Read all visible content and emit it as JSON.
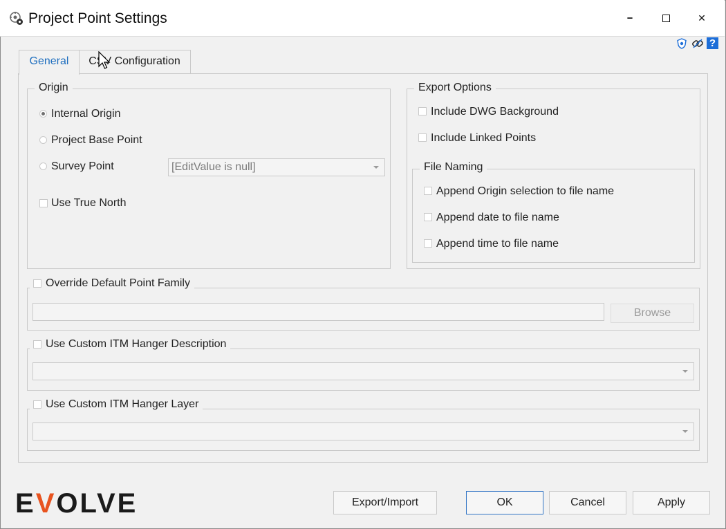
{
  "window": {
    "title": "Project Point Settings",
    "icon": "settings-gear-icon",
    "controls": [
      "minimize-icon",
      "maximize-icon",
      "close-icon"
    ],
    "minimize_glyph": "🗕",
    "maximize_glyph": "▢",
    "close_glyph": "✕"
  },
  "toolbar_icons": [
    "shield-icon",
    "link-icon",
    "help-icon"
  ],
  "tabs": [
    {
      "label": "General",
      "active": true
    },
    {
      "label": "CSV Configuration",
      "active": false
    }
  ],
  "origin": {
    "legend": "Origin",
    "options": [
      {
        "label": "Internal Origin",
        "selected": true
      },
      {
        "label": "Project Base Point",
        "selected": false
      },
      {
        "label": "Survey Point",
        "selected": false
      }
    ],
    "survey_point_combo": "[EditValue is null]",
    "use_true_north": "Use True North"
  },
  "export": {
    "legend": "Export Options",
    "include_dwg": "Include DWG Background",
    "include_linked": "Include Linked Points",
    "file_naming": {
      "legend": "File Naming",
      "append_origin": "Append Origin selection to file name",
      "append_date": "Append date to file name",
      "append_time": "Append time to file name"
    }
  },
  "override_family": {
    "label": "Override Default Point Family",
    "path": "",
    "browse": "Browse"
  },
  "custom_desc": {
    "label": "Use Custom ITM Hanger Description",
    "value": ""
  },
  "custom_layer": {
    "label": "Use Custom ITM Hanger Layer",
    "value": ""
  },
  "footer": {
    "logo_pre": "E",
    "logo_v": "V",
    "logo_post": "OLVE",
    "export_import": "Export/Import",
    "ok": "OK",
    "cancel": "Cancel",
    "apply": "Apply"
  },
  "colors": {
    "accent": "#1f6fbf",
    "brand_orange": "#e8531f",
    "help_blue": "#1d6ed8"
  }
}
